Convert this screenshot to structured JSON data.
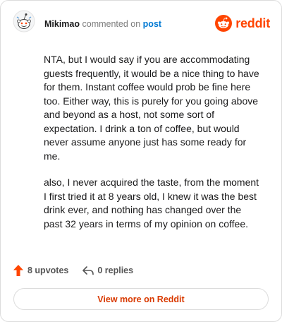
{
  "comment": {
    "username": "Mikimao",
    "action_text": "commented on",
    "target_link": "post",
    "avatar_icon": "snoo-avatar-icon",
    "paragraphs": [
      "NTA, but I would say if you are accommodating guests frequently, it would be a nice thing to have for them. Instant coffee would prob be fine here too. Either way, this is purely for you going above and beyond as a host, not some sort of expectation. I drink a ton of coffee, but would never assume anyone just has some ready for me.",
      "also, I never acquired the taste, from the moment I first tried it at 8 years old, I knew it was the best drink ever, and nothing has changed over the past 32 years in terms of my opinion on coffee."
    ]
  },
  "brand": {
    "wordmark": "reddit",
    "color": "#ff4500",
    "icon": "reddit-logo-icon"
  },
  "stats": {
    "upvotes_label": "8 upvotes",
    "replies_label": "0 replies",
    "upvote_color": "#ff4500"
  },
  "footer": {
    "view_more_label": "View more on Reddit",
    "link_color": "#d93a00"
  }
}
